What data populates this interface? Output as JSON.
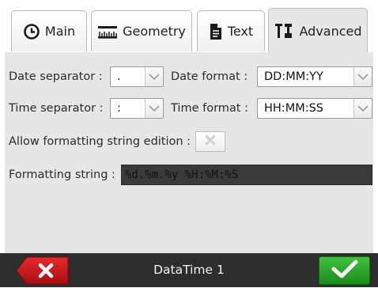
{
  "tabs": [
    {
      "label": "Main",
      "icon": "clock-icon",
      "active": false
    },
    {
      "label": "Geometry",
      "icon": "ruler-icon",
      "active": false
    },
    {
      "label": "Text",
      "icon": "document-icon",
      "active": false
    },
    {
      "label": "Advanced",
      "icon": "tools-icon",
      "active": true
    }
  ],
  "fields": {
    "date_separator": {
      "label": "Date separator :",
      "value": "."
    },
    "date_format": {
      "label": "Date format :",
      "value": "DD:MM:YY"
    },
    "time_separator": {
      "label": "Time separator :",
      "value": ":"
    },
    "time_format": {
      "label": "Time format :",
      "value": "HH:MM:SS"
    },
    "allow_edit": {
      "label": "Allow formatting string edition :",
      "checked": false
    },
    "formatting_string": {
      "label": "Formatting string :",
      "value": "%d.%m.%y %H:%M:%S"
    }
  },
  "footer": {
    "title": "DataTime 1"
  },
  "colors": {
    "panel": "#e6e6e6",
    "footer": "#2d2d2d",
    "cancel": "#c8171b",
    "ok": "#2aa52a"
  }
}
